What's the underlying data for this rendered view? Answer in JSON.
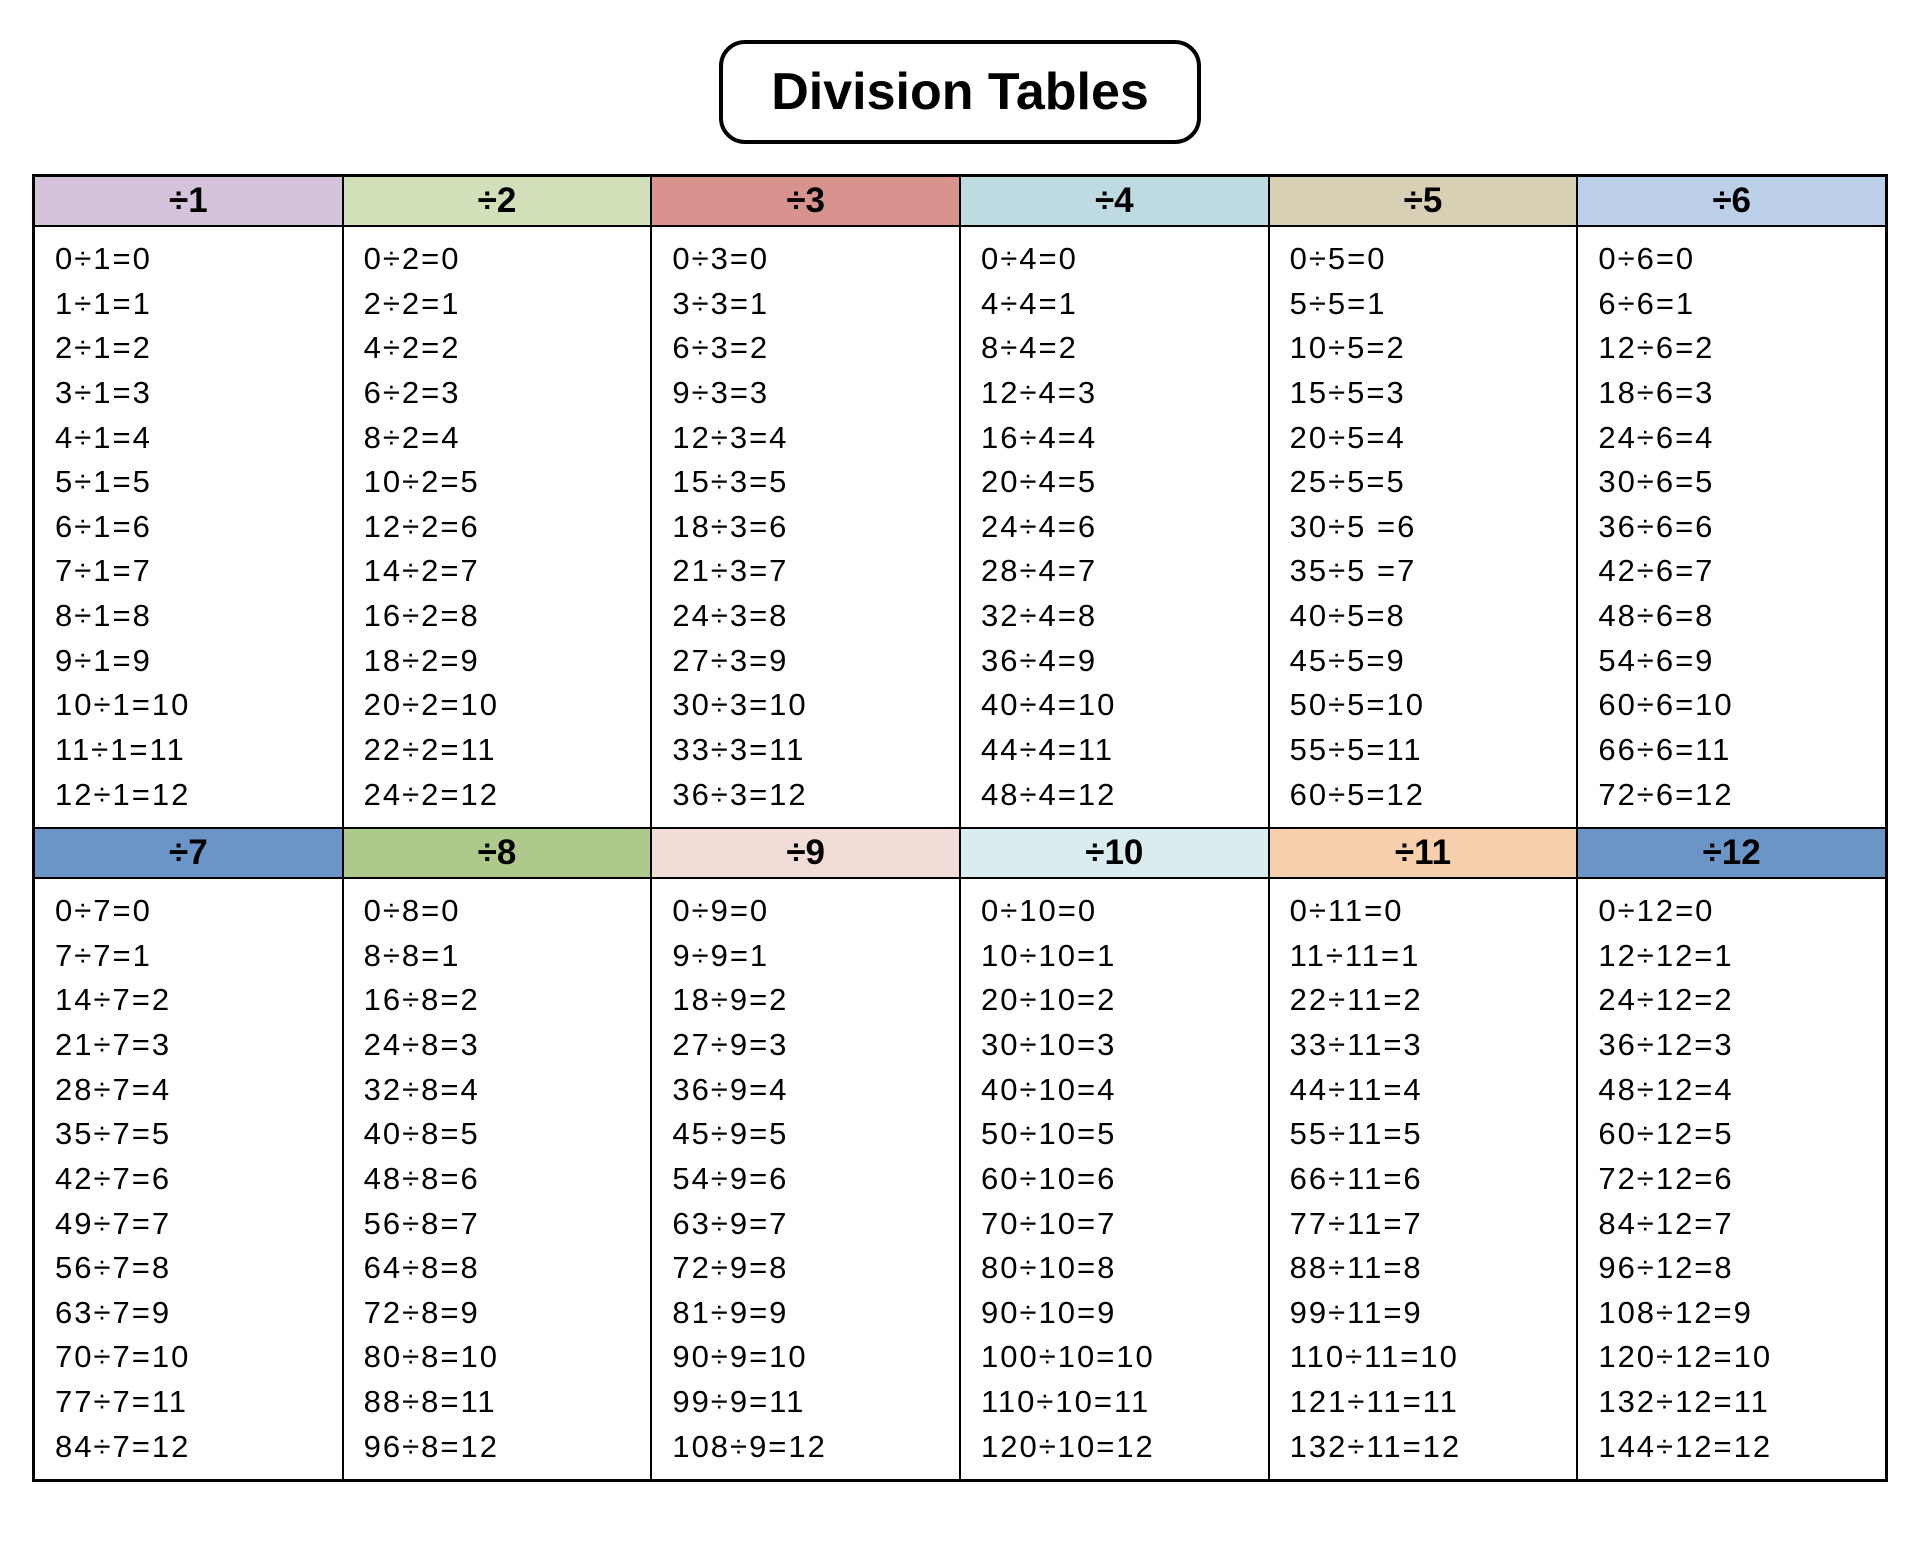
{
  "title": "Division Tables",
  "colors": {
    "c1": "#d5c3dc",
    "c2": "#d1e0b8",
    "c3": "#d9938f",
    "c4": "#bedbe2",
    "c5": "#d8d0b5",
    "c6": "#bbcfe9",
    "c7": "#6b95c6",
    "c8": "#aec98c",
    "c9": "#f1dcd8",
    "c10": "#d9edee",
    "c11": "#f6cfad",
    "c12": "#6b95c6"
  },
  "tables": [
    {
      "divisor": 1,
      "color_key": "c1",
      "header": "÷1",
      "rows": [
        "0÷1=0",
        "1÷1=1",
        "2÷1=2",
        "3÷1=3",
        "4÷1=4",
        "5÷1=5",
        "6÷1=6",
        "7÷1=7",
        "8÷1=8",
        "9÷1=9",
        "10÷1=10",
        "11÷1=11",
        "12÷1=12"
      ]
    },
    {
      "divisor": 2,
      "color_key": "c2",
      "header": "÷2",
      "rows": [
        "0÷2=0",
        "2÷2=1",
        "4÷2=2",
        "6÷2=3",
        "8÷2=4",
        "10÷2=5",
        "12÷2=6",
        "14÷2=7",
        "16÷2=8",
        "18÷2=9",
        "20÷2=10",
        "22÷2=11",
        "24÷2=12"
      ]
    },
    {
      "divisor": 3,
      "color_key": "c3",
      "header": "÷3",
      "rows": [
        "0÷3=0",
        "3÷3=1",
        "6÷3=2",
        "9÷3=3",
        "12÷3=4",
        "15÷3=5",
        "18÷3=6",
        "21÷3=7",
        "24÷3=8",
        "27÷3=9",
        "30÷3=10",
        "33÷3=11",
        "36÷3=12"
      ]
    },
    {
      "divisor": 4,
      "color_key": "c4",
      "header": "÷4",
      "rows": [
        "0÷4=0",
        "4÷4=1",
        "8÷4=2",
        "12÷4=3",
        "16÷4=4",
        "20÷4=5",
        "24÷4=6",
        "28÷4=7",
        "32÷4=8",
        "36÷4=9",
        "40÷4=10",
        "44÷4=11",
        "48÷4=12"
      ]
    },
    {
      "divisor": 5,
      "color_key": "c5",
      "header": "÷5",
      "rows": [
        "0÷5=0",
        "5÷5=1",
        "10÷5=2",
        "15÷5=3",
        "20÷5=4",
        "25÷5=5",
        "30÷5 =6",
        "35÷5 =7",
        "40÷5=8",
        "45÷5=9",
        "50÷5=10",
        "55÷5=11",
        "60÷5=12"
      ]
    },
    {
      "divisor": 6,
      "color_key": "c6",
      "header": "÷6",
      "rows": [
        "0÷6=0",
        "6÷6=1",
        "12÷6=2",
        "18÷6=3",
        "24÷6=4",
        "30÷6=5",
        "36÷6=6",
        "42÷6=7",
        "48÷6=8",
        "54÷6=9",
        "60÷6=10",
        "66÷6=11",
        "72÷6=12"
      ]
    },
    {
      "divisor": 7,
      "color_key": "c7",
      "header": "÷7",
      "rows": [
        "0÷7=0",
        "7÷7=1",
        "14÷7=2",
        "21÷7=3",
        "28÷7=4",
        "35÷7=5",
        "42÷7=6",
        "49÷7=7",
        "56÷7=8",
        "63÷7=9",
        "70÷7=10",
        "77÷7=11",
        "84÷7=12"
      ]
    },
    {
      "divisor": 8,
      "color_key": "c8",
      "header": "÷8",
      "rows": [
        "0÷8=0",
        "8÷8=1",
        "16÷8=2",
        "24÷8=3",
        "32÷8=4",
        "40÷8=5",
        "48÷8=6",
        "56÷8=7",
        "64÷8=8",
        "72÷8=9",
        "80÷8=10",
        "88÷8=11",
        "96÷8=12"
      ]
    },
    {
      "divisor": 9,
      "color_key": "c9",
      "header": "÷9",
      "rows": [
        "0÷9=0",
        "9÷9=1",
        "18÷9=2",
        "27÷9=3",
        "36÷9=4",
        "45÷9=5",
        "54÷9=6",
        "63÷9=7",
        "72÷9=8",
        "81÷9=9",
        "90÷9=10",
        "99÷9=11",
        "108÷9=12"
      ]
    },
    {
      "divisor": 10,
      "color_key": "c10",
      "header": "÷10",
      "rows": [
        "0÷10=0",
        "10÷10=1",
        "20÷10=2",
        "30÷10=3",
        "40÷10=4",
        "50÷10=5",
        "60÷10=6",
        "70÷10=7",
        "80÷10=8",
        "90÷10=9",
        "100÷10=10",
        "110÷10=11",
        "120÷10=12"
      ]
    },
    {
      "divisor": 11,
      "color_key": "c11",
      "header": "÷11",
      "rows": [
        "0÷11=0",
        "11÷11=1",
        "22÷11=2",
        "33÷11=3",
        "44÷11=4",
        "55÷11=5",
        "66÷11=6",
        "77÷11=7",
        "88÷11=8",
        "99÷11=9",
        "110÷11=10",
        "121÷11=11",
        "132÷11=12"
      ]
    },
    {
      "divisor": 12,
      "color_key": "c12",
      "header": "÷12",
      "rows": [
        "0÷12=0",
        "12÷12=1",
        "24÷12=2",
        "36÷12=3",
        "48÷12=4",
        "60÷12=5",
        "72÷12=6",
        "84÷12=7",
        "96÷12=8",
        "108÷12=9",
        "120÷12=10",
        "132÷12=11",
        "144÷12=12"
      ]
    }
  ]
}
